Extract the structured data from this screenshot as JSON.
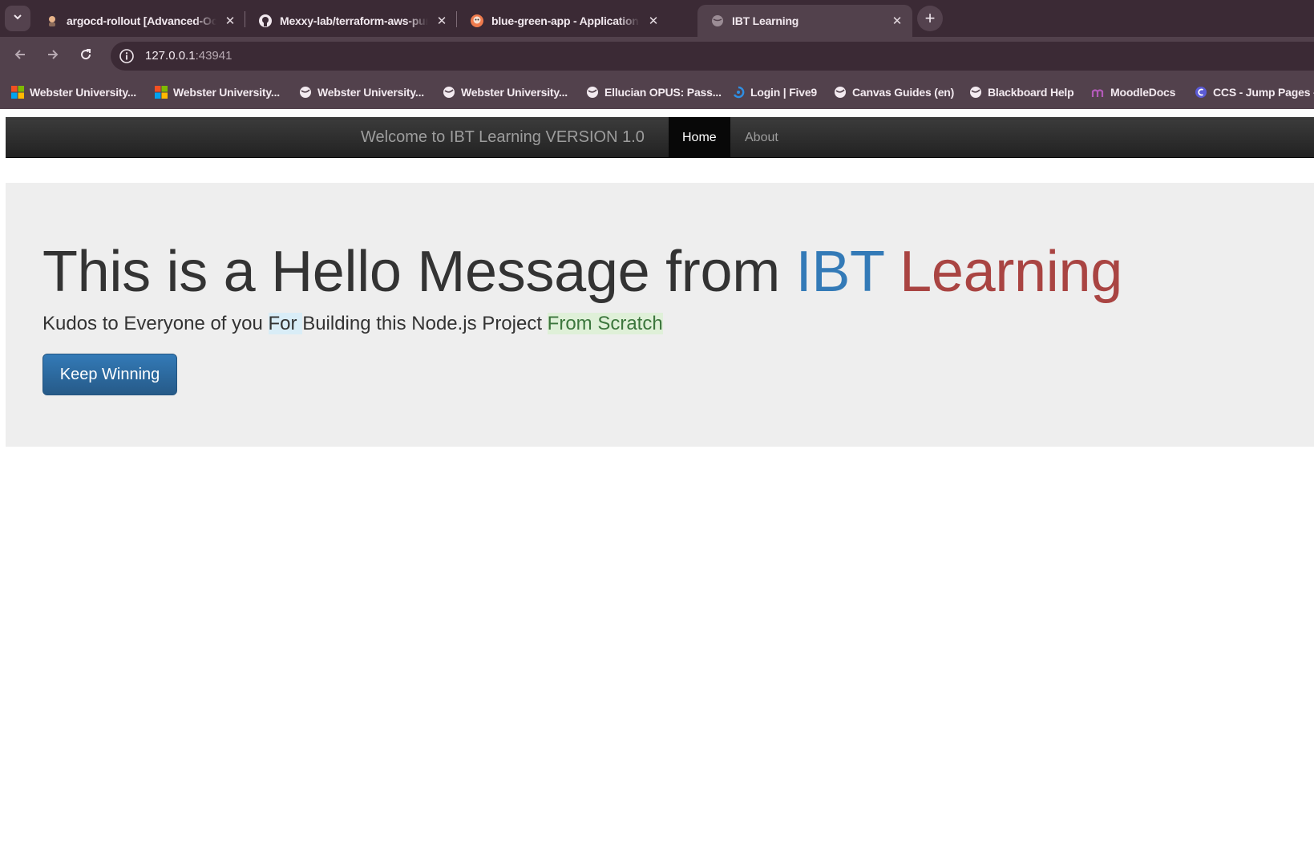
{
  "browser": {
    "tabs": [
      {
        "title": "argocd-rollout [Advanced-Octo",
        "icon": "octocat-avatar-icon",
        "active": false
      },
      {
        "title": "Mexxy-lab/terraform-aws-pum",
        "icon": "github-icon",
        "active": false
      },
      {
        "title": "blue-green-app - Application D",
        "icon": "argo-icon",
        "active": false
      },
      {
        "title": "IBT Learning",
        "icon": "globe-icon",
        "active": true
      }
    ],
    "url_host": "127.0.0.1",
    "url_port": ":43941",
    "bookmarks": [
      {
        "label": "Webster University...",
        "icon": "microsoft-icon"
      },
      {
        "label": "Webster University...",
        "icon": "microsoft-icon"
      },
      {
        "label": "Webster University...",
        "icon": "globe-icon"
      },
      {
        "label": "Webster University...",
        "icon": "globe-icon"
      },
      {
        "label": "Ellucian OPUS: Pass...",
        "icon": "globe-icon"
      },
      {
        "label": "Login | Five9",
        "icon": "five9-icon"
      },
      {
        "label": "Canvas Guides (en)",
        "icon": "globe-icon"
      },
      {
        "label": "Blackboard Help",
        "icon": "globe-icon"
      },
      {
        "label": "MoodleDocs",
        "icon": "moodle-icon"
      },
      {
        "label": "CCS - Jump Pages -...",
        "icon": "ccs-icon"
      }
    ]
  },
  "page": {
    "navbar": {
      "brand": "Welcome to IBT Learning VERSION 1.0",
      "links": [
        "Home",
        "About"
      ],
      "active": "Home"
    },
    "jumbotron": {
      "headline_prefix": "This is a Hello Message from ",
      "headline_blue": "IBT",
      "headline_red": "Learning",
      "lead_part1": "Kudos to Everyone of you ",
      "lead_highlight_blue": "For ",
      "lead_part2": "Building this Node.js Project ",
      "lead_highlight_green": "From Scratch",
      "button_label": "Keep Winning"
    }
  },
  "colors": {
    "tabstrip": "#3b2a35",
    "toolbar": "#52414c",
    "navbar": "#222222",
    "jumbotron": "#eeeeee",
    "brand_blue": "#337ab7",
    "brand_red": "#a94442",
    "button": "#2d6da3"
  }
}
